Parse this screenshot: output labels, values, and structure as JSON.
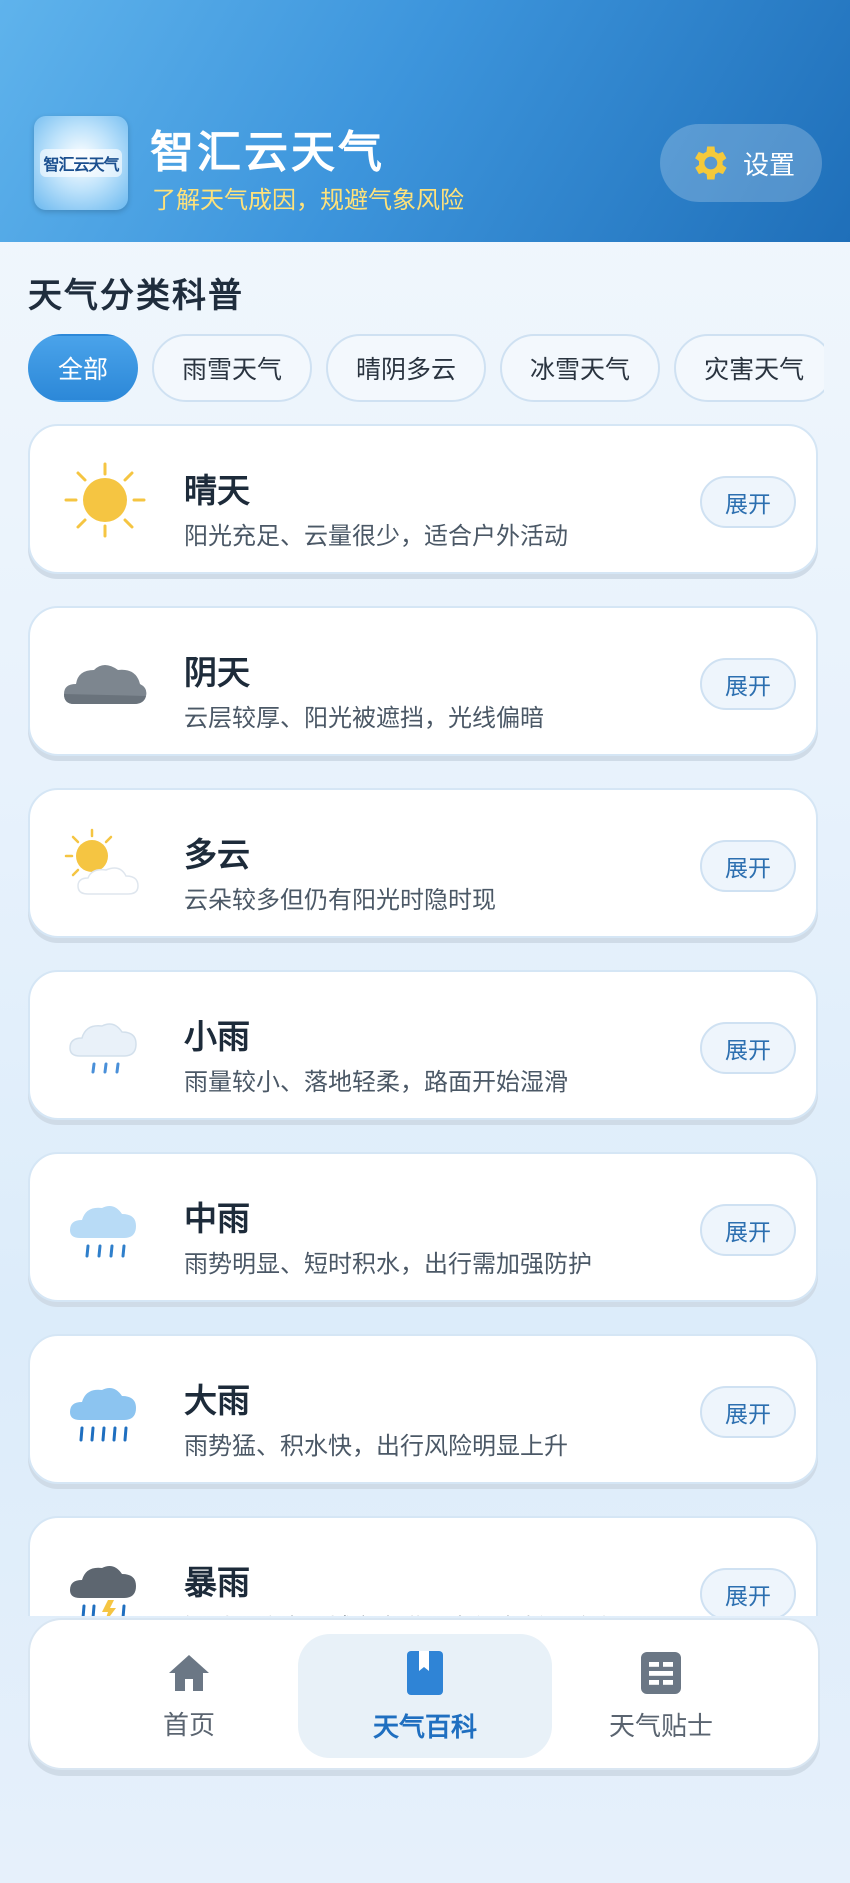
{
  "header": {
    "logo_text": "智汇云天气",
    "title": "智汇云天气",
    "subtitle": "了解天气成因，规避气象风险",
    "settings_label": "设置"
  },
  "section": {
    "title": "天气分类科普"
  },
  "filters": [
    {
      "label": "全部",
      "active": true
    },
    {
      "label": "雨雪天气",
      "active": false
    },
    {
      "label": "晴阴多云",
      "active": false
    },
    {
      "label": "冰雪天气",
      "active": false
    },
    {
      "label": "灾害天气",
      "active": false
    }
  ],
  "cards": [
    {
      "name": "晴天",
      "desc": "阳光充足、云量很少，适合户外活动",
      "icon": "sun-icon",
      "expand": "展开"
    },
    {
      "name": "阴天",
      "desc": "云层较厚、阳光被遮挡，光线偏暗",
      "icon": "cloud-icon",
      "expand": "展开"
    },
    {
      "name": "多云",
      "desc": "云朵较多但仍有阳光时隐时现",
      "icon": "partly-cloudy-icon",
      "expand": "展开"
    },
    {
      "name": "小雨",
      "desc": "雨量较小、落地轻柔，路面开始湿滑",
      "icon": "light-rain-icon",
      "expand": "展开"
    },
    {
      "name": "中雨",
      "desc": "雨势明显、短时积水，出行需加强防护",
      "icon": "moderate-rain-icon",
      "expand": "展开"
    },
    {
      "name": "大雨",
      "desc": "雨势猛、积水快，出行风险明显上升",
      "icon": "heavy-rain-icon",
      "expand": "展开"
    },
    {
      "name": "暴雨",
      "desc": "短时强降水，城市内涝和出行中断风险高",
      "icon": "storm-icon",
      "expand": "展开"
    }
  ],
  "nav": [
    {
      "label": "首页",
      "icon": "home-icon",
      "active": false
    },
    {
      "label": "天气百科",
      "icon": "book-icon",
      "active": true
    },
    {
      "label": "天气贴士",
      "icon": "tips-icon",
      "active": false
    }
  ],
  "colors": {
    "accent": "#2c88d8",
    "header_start": "#5fb3ec",
    "header_end": "#1f6fb9",
    "subtitle": "#ffe27a"
  }
}
